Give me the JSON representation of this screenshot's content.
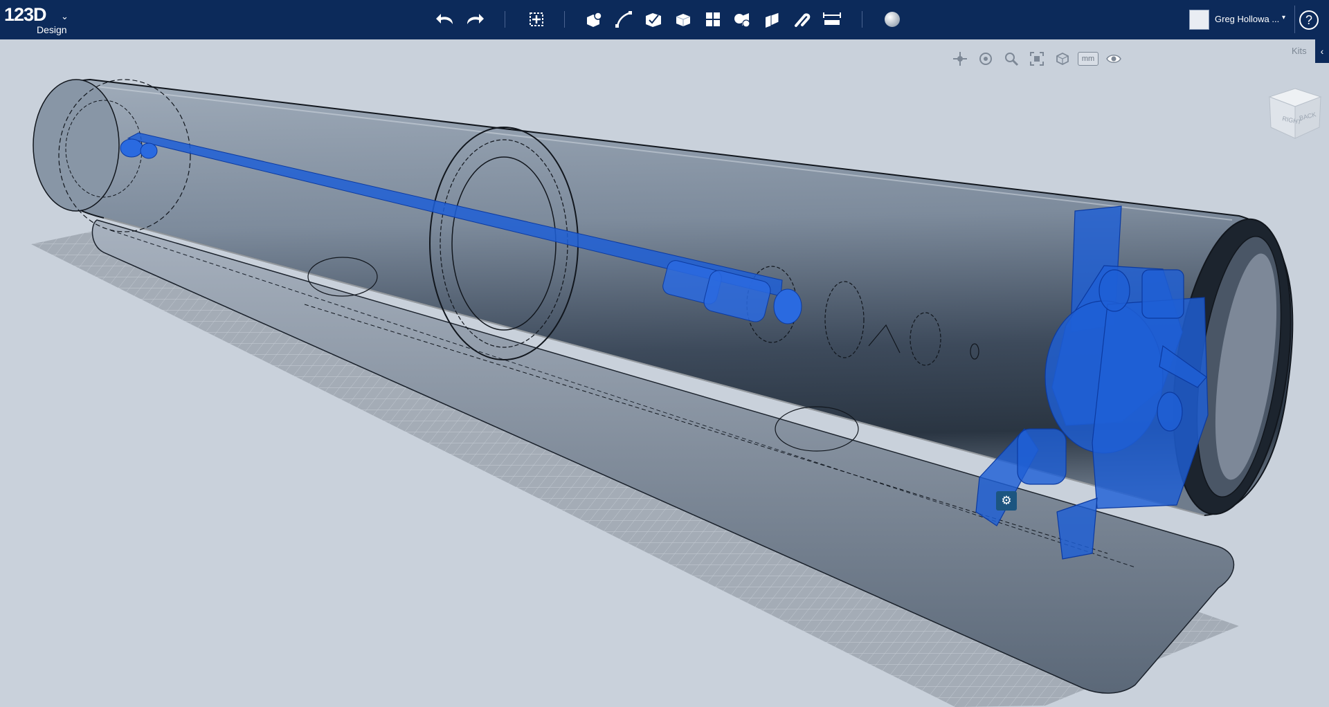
{
  "app": {
    "logo_text": "123D",
    "logo_subtext": "Design",
    "logo_menu_glyph": "⌄"
  },
  "toolbar": {
    "tools": [
      "undo-icon",
      "redo-icon",
      "transform-icon",
      "primitives-icon",
      "sketch-icon",
      "construct-icon",
      "modify-icon",
      "pattern-icon",
      "grouping-icon",
      "combine-icon",
      "snap-icon",
      "measure-icon",
      "material-icon"
    ]
  },
  "user": {
    "name": "Greg Hollowa ...",
    "caret": "▾"
  },
  "help": {
    "label": "?"
  },
  "navigation": {
    "icons": [
      "pan-icon",
      "orbit-icon",
      "zoom-icon",
      "fit-icon",
      "view-mode-icon"
    ],
    "units_label": "mm",
    "visibility_icon": "eye-icon"
  },
  "kits": {
    "label": "Kits",
    "tab_glyph": "‹"
  },
  "viewcube": {
    "faces": [
      "RIGHT",
      "BACK"
    ]
  },
  "selection_handle": {
    "glyph": "⚙"
  },
  "colors": {
    "topbar": "#0c2a5a",
    "viewport_bg": "#c9d1db",
    "selected_part": "#1f5fd6",
    "body_dark": "#2d3946"
  }
}
